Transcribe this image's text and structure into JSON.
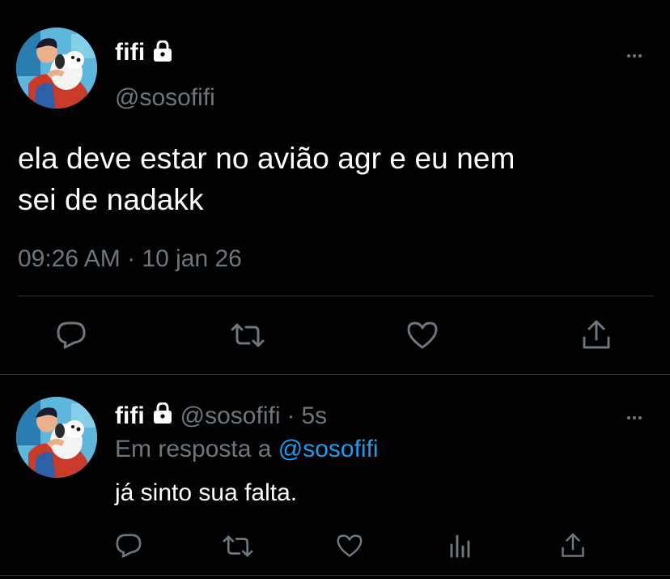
{
  "main_tweet": {
    "display_name": "fifi",
    "handle": "@sosofifi",
    "text_line1": "ela deve estar no avião agr e eu nem",
    "text_line2": "sei de nadakk",
    "timestamp": "09:26 AM · 10 jan 26"
  },
  "reply_tweet": {
    "display_name": "fifi",
    "handle": "@sosofifi",
    "separator": "·",
    "time": "5s",
    "reply_to_prefix": "Em resposta a",
    "reply_to_handle": "@sosofifi",
    "text": "já sinto sua falta."
  },
  "icons": {
    "lock": "lock-icon",
    "more": "more-icon",
    "reply": "reply-icon",
    "retweet": "retweet-icon",
    "like": "heart-icon",
    "share": "share-icon",
    "analytics": "analytics-icon"
  },
  "colors": {
    "background": "#000000",
    "text_primary": "#ffffff",
    "text_secondary": "#6e767d",
    "link": "#1d9bf0",
    "divider": "#2f3336"
  }
}
